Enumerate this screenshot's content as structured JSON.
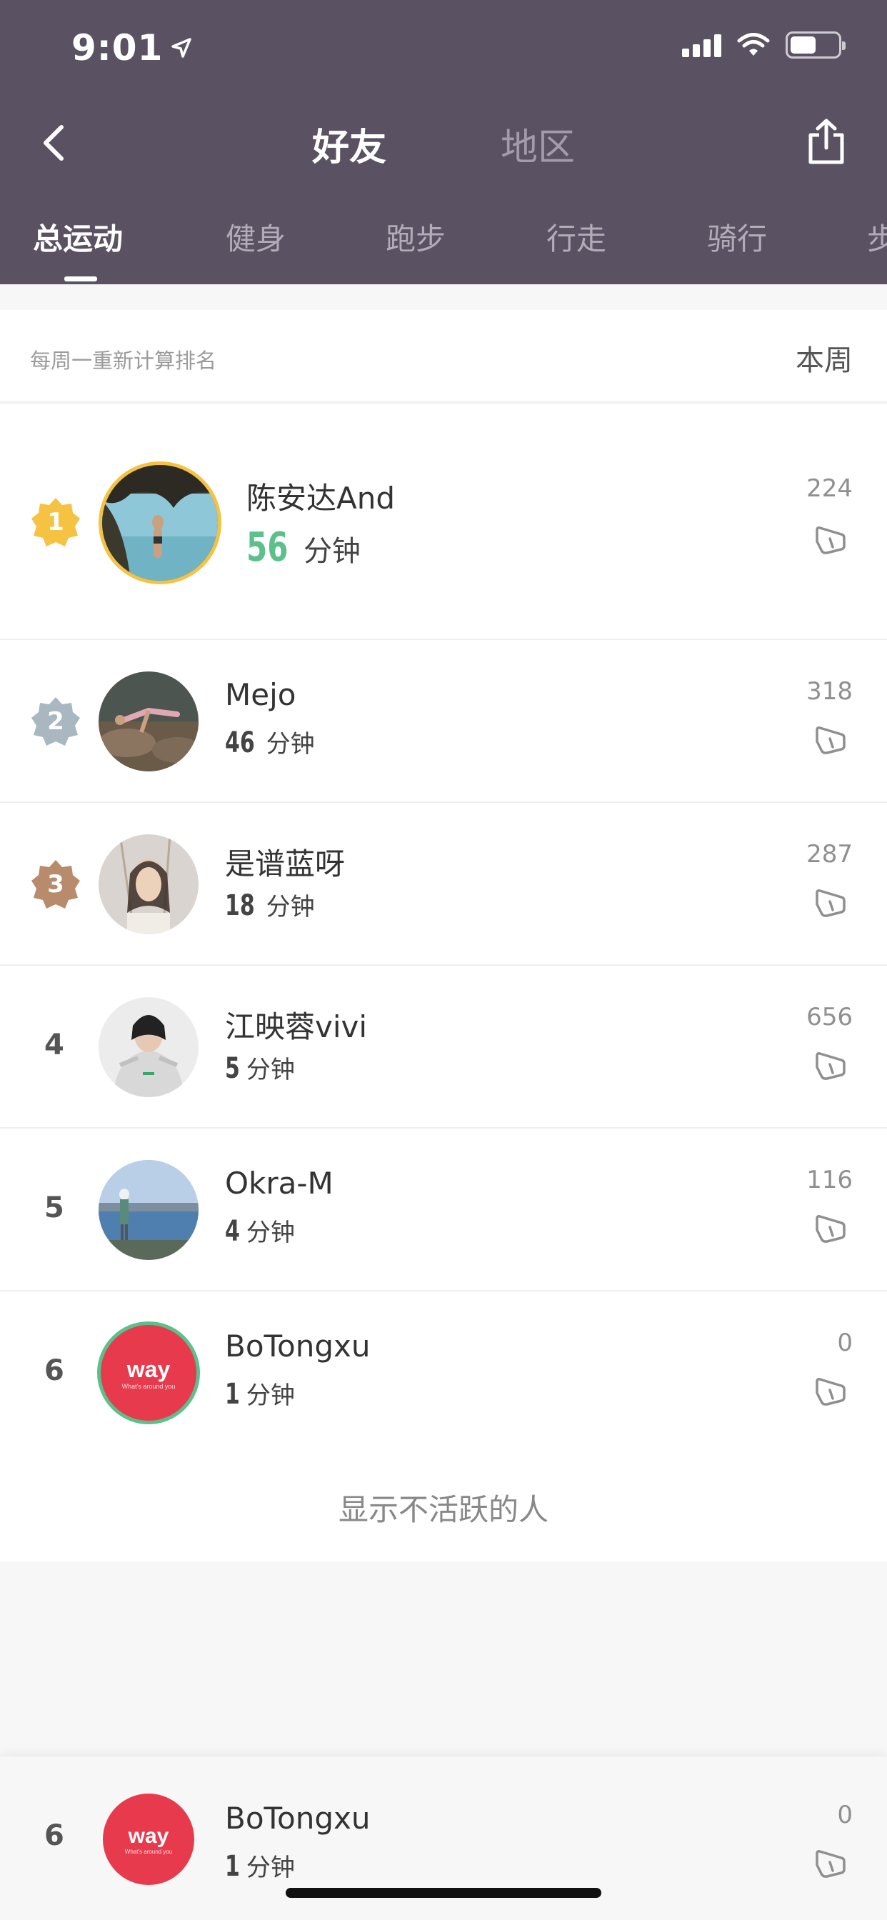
{
  "status_bar": {
    "time": "9:01"
  },
  "header": {
    "tabs": [
      {
        "label": "好友",
        "active": true
      },
      {
        "label": "地区",
        "active": false
      }
    ]
  },
  "sport_tabs": [
    {
      "label": "总运动",
      "active": true
    },
    {
      "label": "健身"
    },
    {
      "label": "跑步"
    },
    {
      "label": "行走"
    },
    {
      "label": "骑行"
    },
    {
      "label": "步"
    }
  ],
  "week": {
    "note": "每周一重新计算排名",
    "value": "本周"
  },
  "ranking": [
    {
      "rank": "1",
      "name": "陈安达And",
      "minutes": "56",
      "unit": "分钟",
      "likes": "224",
      "avatar": "photo-beach",
      "badge_color": "#f5c242",
      "highlight_color": "#5cc08b"
    },
    {
      "rank": "2",
      "name": "Mejo",
      "minutes": "46",
      "unit": "分钟",
      "likes": "318",
      "avatar": "photo-yoga",
      "badge_color": "#a9b7c1"
    },
    {
      "rank": "3",
      "name": "是谱蓝呀",
      "minutes": "18",
      "unit": "分钟",
      "likes": "287",
      "avatar": "photo-portrait",
      "badge_color": "#b98b6d"
    },
    {
      "rank": "4",
      "name": "江映蓉vivi",
      "minutes": "5",
      "unit": "分钟",
      "likes": "656",
      "avatar": "photo-hoodie"
    },
    {
      "rank": "5",
      "name": "Okra-M",
      "minutes": "4",
      "unit": "分钟",
      "likes": "116",
      "avatar": "photo-lake"
    },
    {
      "rank": "6",
      "name": "BoTongxu",
      "minutes": "1",
      "unit": "分钟",
      "likes": "0",
      "avatar": "way-logo"
    }
  ],
  "show_inactive_label": "显示不活跃的人",
  "self_row": {
    "rank": "6",
    "name": "BoTongxu",
    "minutes": "1",
    "unit": "分钟",
    "likes": "0",
    "avatar": "way-logo"
  },
  "way_logo": {
    "text": "way",
    "tagline": "What's around you"
  },
  "colors": {
    "header_bg": "#5a5263",
    "first_place_green": "#5cc08b",
    "way_red": "#e83a4d"
  }
}
